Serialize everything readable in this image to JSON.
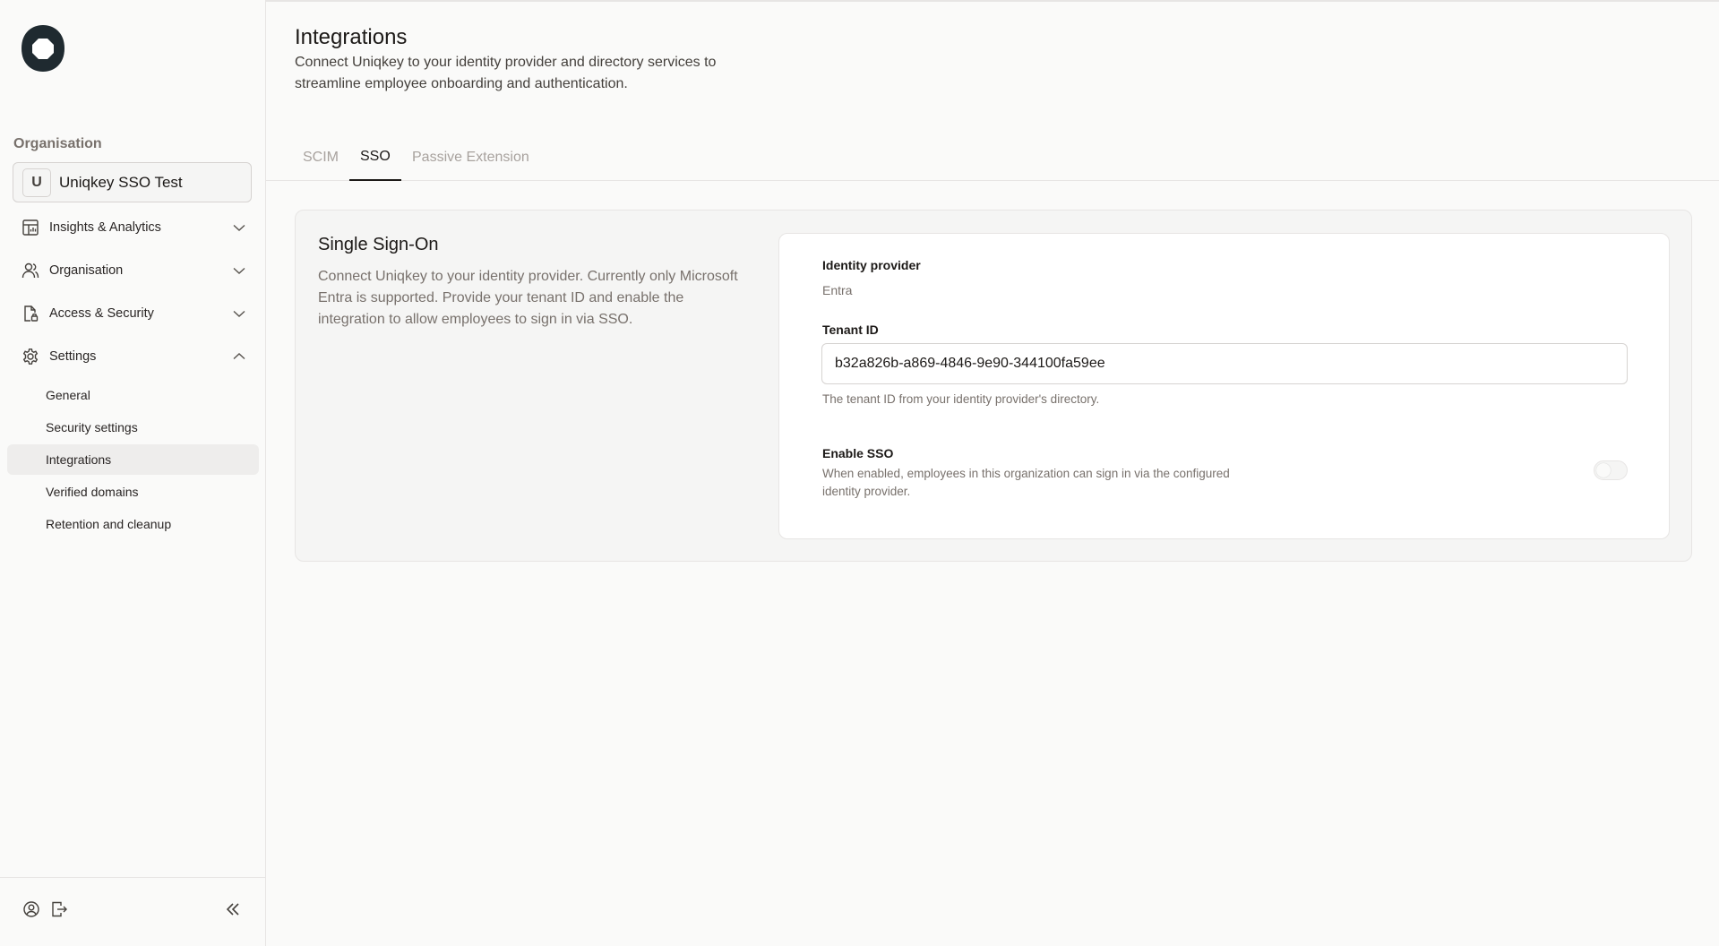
{
  "sidebar": {
    "org_heading": "Organisation",
    "org_selector": {
      "initial": "U",
      "name": "Uniqkey SSO Test"
    },
    "nav": [
      {
        "label": "Insights & Analytics",
        "icon": "chart-layout-icon",
        "expanded": false
      },
      {
        "label": "Organisation",
        "icon": "users-icon",
        "expanded": false
      },
      {
        "label": "Access & Security",
        "icon": "file-lock-icon",
        "expanded": false
      },
      {
        "label": "Settings",
        "icon": "gear-icon",
        "expanded": true
      }
    ],
    "settings_items": [
      {
        "label": "General",
        "active": false
      },
      {
        "label": "Security settings",
        "active": false
      },
      {
        "label": "Integrations",
        "active": true
      },
      {
        "label": "Verified domains",
        "active": false
      },
      {
        "label": "Retention and cleanup",
        "active": false
      }
    ],
    "footer": {
      "profile_icon": "user-circle-icon",
      "logout_icon": "logout-icon",
      "collapse_icon": "chevrons-left-icon"
    }
  },
  "header": {
    "title": "Integrations",
    "description": "Connect Uniqkey to your identity provider and directory services to streamline employee onboarding and authentication."
  },
  "tabs": [
    {
      "label": "SCIM",
      "active": false
    },
    {
      "label": "SSO",
      "active": true
    },
    {
      "label": "Passive Extension",
      "active": false
    }
  ],
  "sso": {
    "title": "Single Sign-On",
    "description": "Connect Uniqkey to your identity provider. Currently only Microsoft Entra is supported. Provide your tenant ID and enable the integration to allow employees to sign in via SSO.",
    "identity_provider_label": "Identity provider",
    "identity_provider_value": "Entra",
    "tenant_label": "Tenant ID",
    "tenant_value": "b32a826b-a869-4846-9e90-344100fa59ee",
    "tenant_help": "The tenant ID from your identity provider's directory.",
    "enable_label": "Enable SSO",
    "enable_help": "When enabled, employees in this organization can sign in via the configured identity provider.",
    "enabled": false
  },
  "colors": {
    "brand": "#1f2a30",
    "background": "#fafaf9",
    "border": "#e7e5e4"
  }
}
